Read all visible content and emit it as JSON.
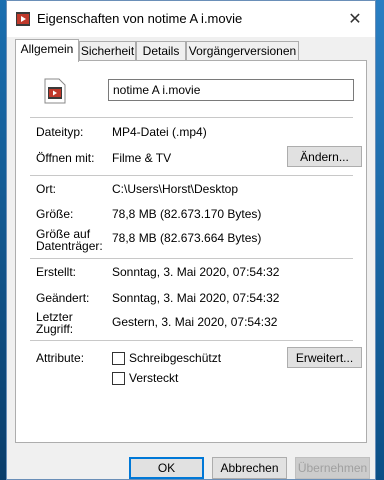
{
  "window": {
    "title": "Eigenschaften von notime A i.movie",
    "close_glyph": "✕"
  },
  "tabs": [
    {
      "label": "Allgemein",
      "active": true
    },
    {
      "label": "Sicherheit",
      "active": false
    },
    {
      "label": "Details",
      "active": false
    },
    {
      "label": "Vorgängerversionen",
      "active": false
    }
  ],
  "file": {
    "name": "notime A i.movie",
    "icon": "movie-file-icon"
  },
  "props": {
    "dateityp": {
      "label": "Dateityp:",
      "value": "MP4-Datei (.mp4)"
    },
    "oeffnen": {
      "label": "Öffnen mit:",
      "value": "Filme & TV",
      "button": "Ändern..."
    },
    "ort": {
      "label": "Ort:",
      "value": "C:\\Users\\Horst\\Desktop"
    },
    "groesse": {
      "label": "Größe:",
      "value": "78,8 MB (82.673.170 Bytes)"
    },
    "groesse_dt": {
      "label_line1": "Größe auf",
      "label_line2": "Datenträger:",
      "value": "78,8 MB (82.673.664 Bytes)"
    },
    "erstellt": {
      "label": "Erstellt:",
      "value": "Sonntag, 3. Mai 2020, 07:54:32"
    },
    "geaendert": {
      "label": "Geändert:",
      "value": "Sonntag, 3. Mai 2020, 07:54:32"
    },
    "zugriff": {
      "label_line1": "Letzter",
      "label_line2": "Zugriff:",
      "value": "Gestern, 3. Mai 2020, 07:54:32"
    },
    "attribute": {
      "label": "Attribute:",
      "readonly": {
        "label": "Schreibgeschützt",
        "checked": false
      },
      "hidden": {
        "label": "Versteckt",
        "checked": false
      },
      "button": "Erweitert..."
    }
  },
  "footer": {
    "ok": "OK",
    "cancel": "Abbrechen",
    "apply": "Übernehmen",
    "apply_enabled": false
  },
  "colors": {
    "accent": "#0078d7",
    "desktop": "#0b4f86"
  }
}
